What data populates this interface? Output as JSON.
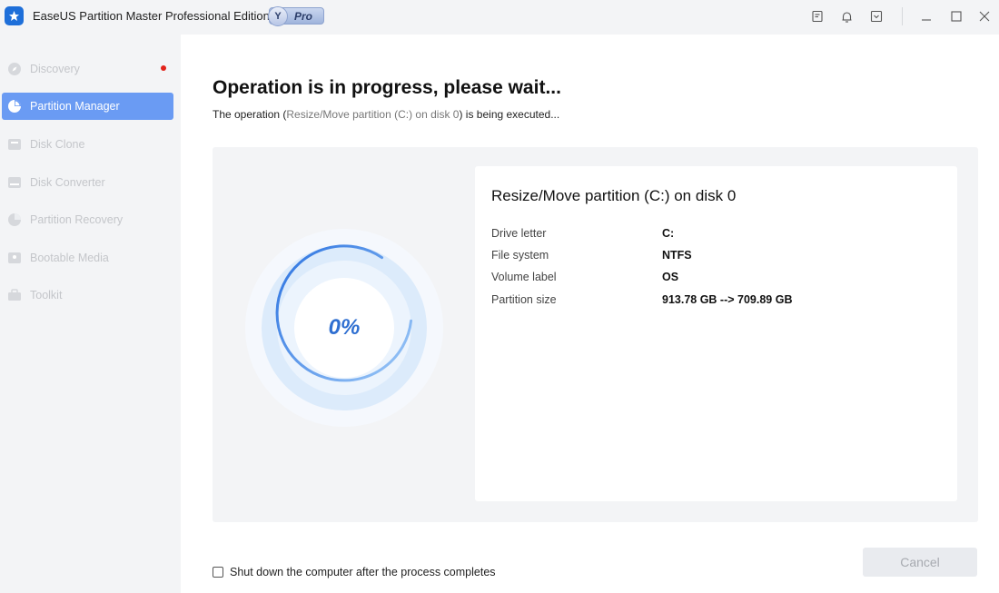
{
  "app": {
    "title": "EaseUS Partition Master Professional Edition",
    "badge_letter": "Y",
    "badge_text": "Pro",
    "icons": [
      "feedback-icon",
      "bell-icon",
      "dropdown-menu-icon",
      "minimize-icon",
      "maximize-icon",
      "close-icon"
    ]
  },
  "sidebar": {
    "items": [
      {
        "label": "Discovery",
        "icon": "compass-icon",
        "active": false,
        "has_notification": true
      },
      {
        "label": "Partition Manager",
        "icon": "pie-chart-icon",
        "active": true
      },
      {
        "label": "Disk Clone",
        "icon": "clone-icon",
        "active": false
      },
      {
        "label": "Disk Converter",
        "icon": "converter-icon",
        "active": false
      },
      {
        "label": "Partition Recovery",
        "icon": "recovery-icon",
        "active": false
      },
      {
        "label": "Bootable Media",
        "icon": "bootable-media-icon",
        "active": false
      },
      {
        "label": "Toolkit",
        "icon": "toolkit-icon",
        "active": false
      }
    ]
  },
  "main": {
    "heading": "Operation is in progress, please wait...",
    "sub_prefix": "The operation (",
    "sub_operation": "Resize/Move partition (C:) on disk 0",
    "sub_suffix": ") is being executed...",
    "progress_text": "0%",
    "progress_value": 0,
    "details": {
      "title": "Resize/Move partition (C:) on disk 0",
      "rows": [
        {
          "label": "Drive letter",
          "value": "C:"
        },
        {
          "label": "File system",
          "value": "NTFS"
        },
        {
          "label": "Volume label",
          "value": "OS"
        },
        {
          "label": "Partition size",
          "value": "913.78 GB --> 709.89 GB"
        }
      ]
    },
    "shutdown_label": "Shut down the computer after the process completes",
    "shutdown_checked": false,
    "cancel_label": "Cancel"
  },
  "colors": {
    "accent": "#6a9bf3",
    "progress": "#2f6fd1",
    "notification": "#e2231a"
  }
}
